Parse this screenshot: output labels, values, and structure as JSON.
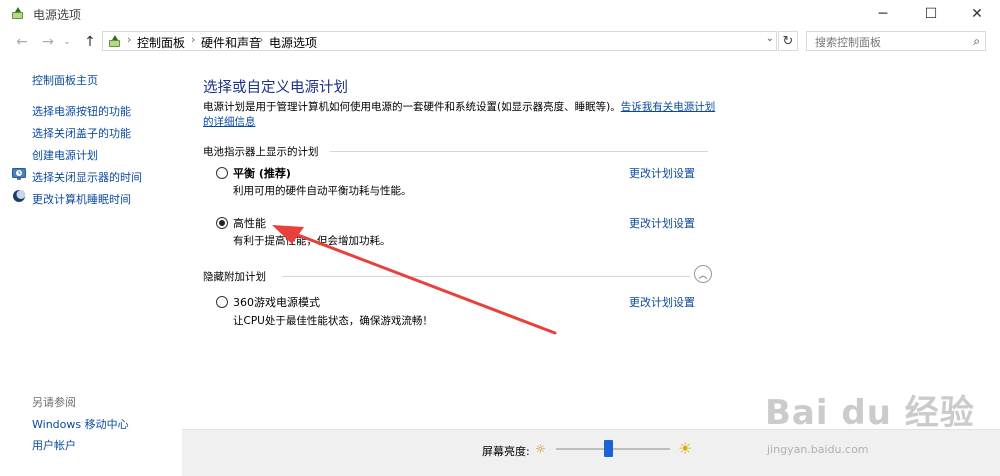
{
  "window": {
    "title": "电源选项",
    "controls": {
      "minimize": "─",
      "maximize": "☐",
      "close": "✕"
    }
  },
  "nav": {
    "back": "←",
    "forward": "→",
    "recent": "⌄",
    "up": "↑",
    "breadcrumbs": [
      "控制面板",
      "硬件和声音",
      "电源选项"
    ],
    "separator": "›",
    "dropdown": "⌄",
    "refresh": "↻",
    "search_placeholder": "搜索控制面板",
    "search_icon": "⌕"
  },
  "help": {
    "label": "?"
  },
  "sidebar": {
    "items": [
      {
        "label": "控制面板主页",
        "icon": ""
      },
      {
        "label": "选择电源按钮的功能",
        "icon": ""
      },
      {
        "label": "选择关闭盖子的功能",
        "icon": ""
      },
      {
        "label": "创建电源计划",
        "icon": ""
      },
      {
        "label": "选择关闭显示器的时间",
        "icon": "monitor-clock-icon"
      },
      {
        "label": "更改计算机睡眠时间",
        "icon": "moon-icon"
      }
    ],
    "see_also_label": "另请参阅",
    "see_also": [
      {
        "label": "Windows 移动中心"
      },
      {
        "label": "用户帐户"
      }
    ]
  },
  "main": {
    "title": "选择或自定义电源计划",
    "description": "电源计划是用于管理计算机如何使用电源的一套硬件和系统设置(如显示器亮度、睡眠等)。",
    "description_link": "告诉我有关电源计划的详细信息",
    "battery_section_label": "电池指示器上显示的计划",
    "hidden_section_label": "隐藏附加计划",
    "collapse_icon": "︿",
    "plans": [
      {
        "name": "平衡 (推荐)",
        "description": "利用可用的硬件自动平衡功耗与性能。",
        "link": "更改计划设置",
        "selected": false
      },
      {
        "name": "高性能",
        "description": "有利于提高性能，但会增加功耗。",
        "link": "更改计划设置",
        "selected": true
      },
      {
        "name": "360游戏电源模式",
        "description": "让CPU处于最佳性能状态，确保游戏流畅！",
        "link": "更改计划设置",
        "selected": false
      }
    ]
  },
  "bottom": {
    "brightness_label": "屏幕亮度:",
    "brightness_level": 0.46,
    "sun_small": "☼",
    "sun_large": "☀"
  },
  "annotation": {
    "arrow_color": "#e8403a"
  },
  "watermark": {
    "text": "Bai du 经验",
    "sub": "jingyan.baidu.com"
  },
  "colors": {
    "accent": "#1e3287",
    "link": "#0a4a9e",
    "slider": "#1a62d6"
  }
}
